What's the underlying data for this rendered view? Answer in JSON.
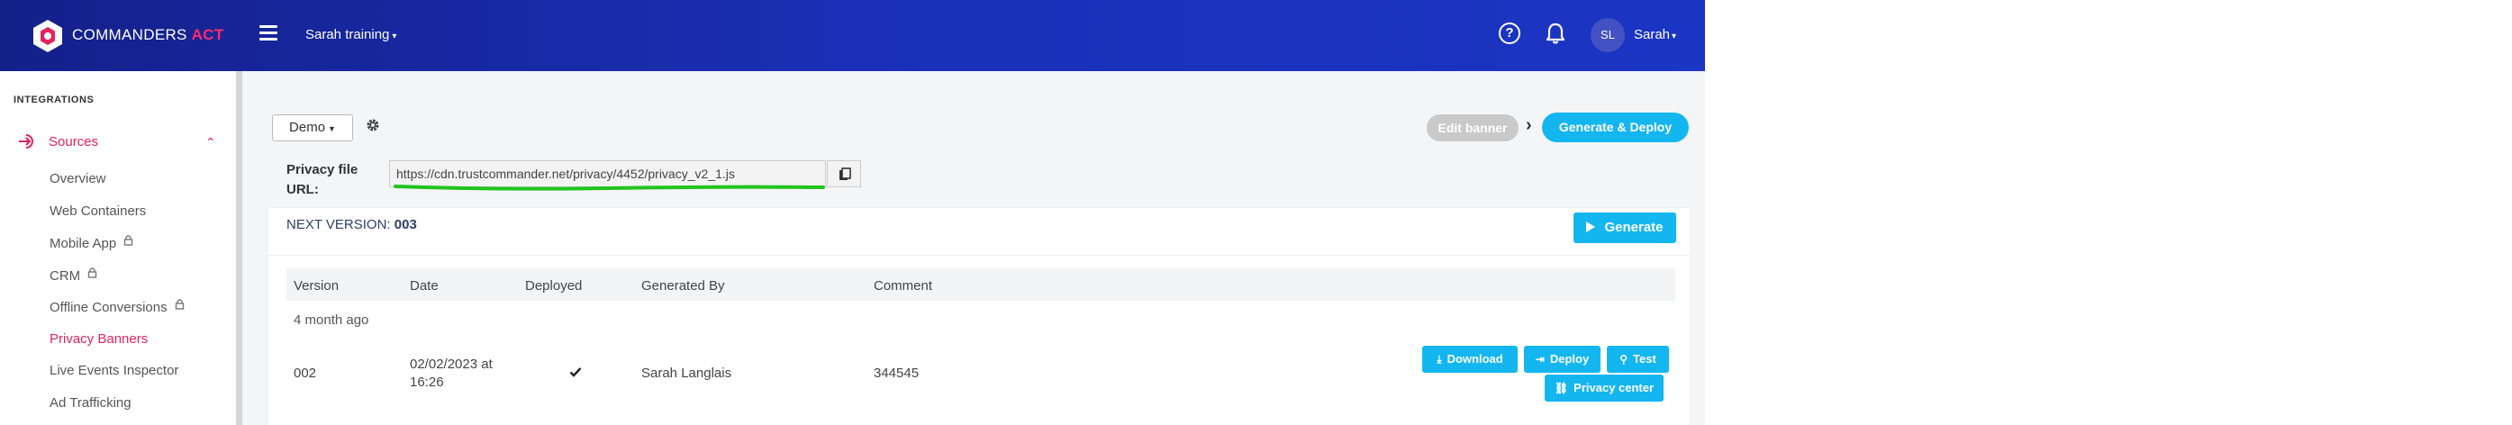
{
  "header": {
    "brand_main": "COMMANDERS",
    "brand_accent": "ACT",
    "workspace": "Sarah training",
    "avatar_initials": "SL",
    "user_name": "Sarah",
    "help_glyph": "?",
    "icons": [
      "menu-icon",
      "help-icon",
      "bell-icon"
    ]
  },
  "sidebar": {
    "section": "INTEGRATIONS",
    "group_label": "Sources",
    "items": [
      {
        "label": "Overview"
      },
      {
        "label": "Web Containers"
      },
      {
        "label": "Mobile App"
      },
      {
        "label": "CRM"
      },
      {
        "label": "Offline Conversions"
      },
      {
        "label": "Privacy Banners"
      },
      {
        "label": "Live Events Inspector"
      },
      {
        "label": "Ad Trafficking"
      }
    ]
  },
  "main": {
    "demo_button": "Demo",
    "steps": {
      "edit": "Edit banner",
      "generate": "Generate & Deploy"
    },
    "url_label": "Privacy file URL:",
    "url_value": "https://cdn.trustcommander.net/privacy/4452/privacy_v2_1.js",
    "next_version_label": "NEXT VERSION:",
    "next_version_value": "003",
    "generate_button": "Generate",
    "table": {
      "headers": [
        "Version",
        "Date",
        "Deployed",
        "Generated By",
        "Comment"
      ],
      "group": "4 month ago",
      "row": {
        "version": "002",
        "date_line1": "02/02/2023 at",
        "date_line2": "16:26",
        "deployed": true,
        "generated_by": "Sarah Langlais",
        "comment": "344545"
      },
      "actions": {
        "download": "Download",
        "deploy": "Deploy",
        "test": "Test",
        "privacy_center": "Privacy center"
      }
    }
  },
  "colors": {
    "header": "#1a2fb6",
    "accent": "#e0245e",
    "button": "#14b6f0",
    "annotation": "#22c41e"
  }
}
